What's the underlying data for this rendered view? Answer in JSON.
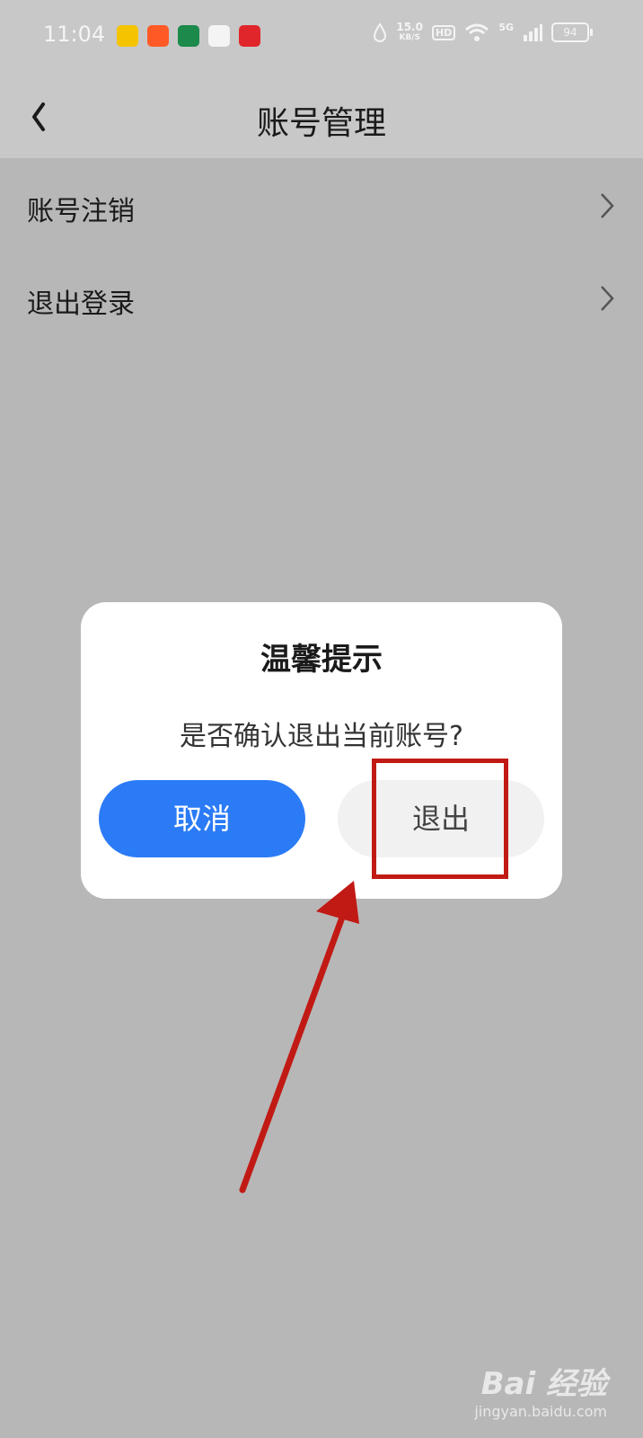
{
  "status_bar": {
    "time": "11:04",
    "speed_value": "15.0",
    "speed_unit": "KB/S",
    "hd": "HD",
    "network": "5G",
    "battery": "94"
  },
  "header": {
    "title": "账号管理"
  },
  "list": [
    {
      "label": "账号注销"
    },
    {
      "label": "退出登录"
    }
  ],
  "dialog": {
    "title": "温馨提示",
    "message": "是否确认退出当前账号?",
    "cancel_label": "取消",
    "exit_label": "退出"
  },
  "watermark": {
    "brand": "Bai 经验",
    "url": "jingyan.baidu.com"
  },
  "colors": {
    "primary": "#2b7bf6",
    "annotation": "#c11a14"
  }
}
